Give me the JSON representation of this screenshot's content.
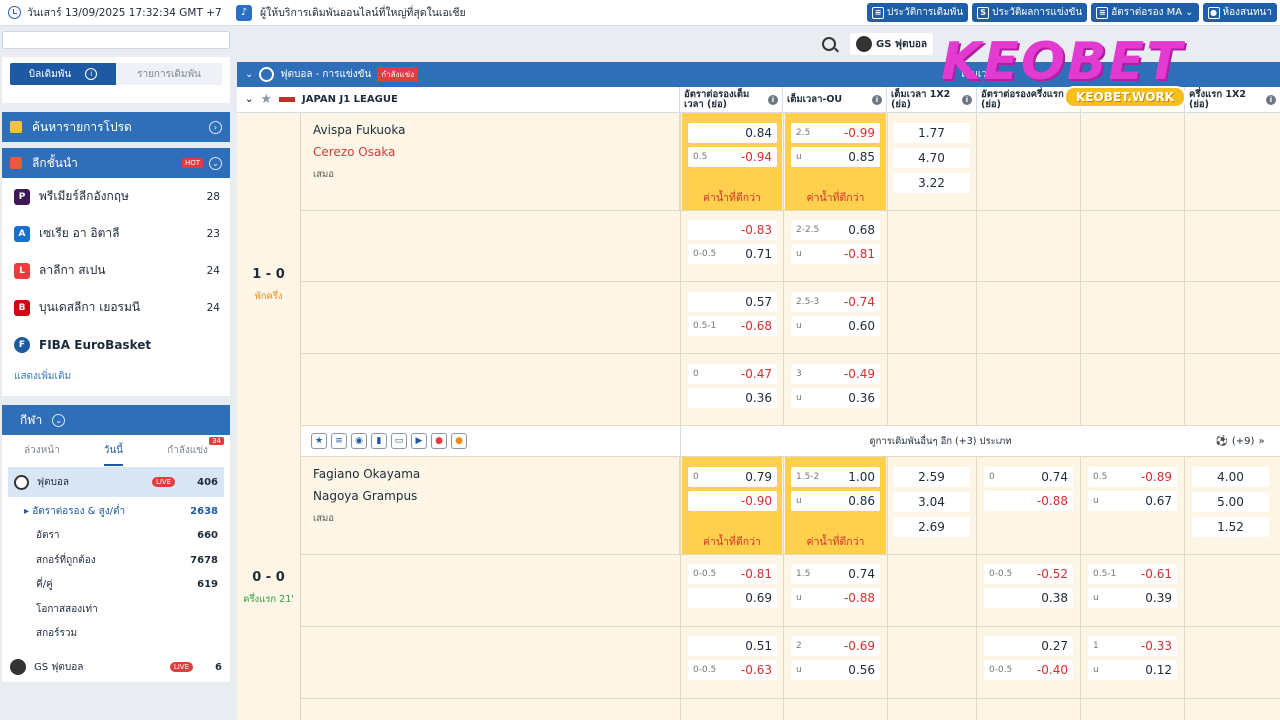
{
  "topbar": {
    "datetime": "วันเสาร์ 13/09/2025 17:32:34 GMT +7",
    "notice": "ผู้ให้บริการเดิมพันออนไลน์ที่ใหญ่ที่สุดในเอเชีย",
    "links": [
      {
        "label": "ประวัติการเดิมพัน",
        "icon": "history-icon"
      },
      {
        "label": "ประวัติผลการแข่งขัน",
        "icon": "results-icon"
      },
      {
        "label": "อัตราต่อรอง MA",
        "icon": "menu-icon"
      },
      {
        "label": "ห้องสนทนา",
        "icon": "chat-icon"
      }
    ]
  },
  "sidebar": {
    "tab_bets": "บิลเดิมพัน",
    "tab_list": "รายการเดิมพัน",
    "favorites": "ค้นหารายการโปรด",
    "top_leagues": "ลีกชั้นนำ",
    "hot": "HOT",
    "leagues": [
      {
        "name": "พรีเมียร์ลีกอังกฤษ",
        "count": "28",
        "color": "#3d195b"
      },
      {
        "name": "เซเรีย อา อิตาลี",
        "count": "23",
        "color": "#1b6fd0"
      },
      {
        "name": "ลาลีกา สเปน",
        "count": "24",
        "color": "#ee3b3b"
      },
      {
        "name": "บุนเดสลีกา เยอรมนี",
        "count": "24",
        "color": "#d20515"
      },
      {
        "name": "FIBA EuroBasket",
        "count": "",
        "color": "#1e5aa3"
      }
    ],
    "show_more": "แสดงเพิ่มเติม",
    "sports": "กีฬา",
    "sport_tabs": [
      "ล่วงหน้า",
      "วันนี้",
      "กำลังแข่ง"
    ],
    "live_count": "34",
    "football": {
      "name": "ฟุตบอล",
      "count": "406",
      "live": "LIVE"
    },
    "subitems": [
      {
        "name": "อัตราต่อรอง & สูง/ต่ำ",
        "count": "2638"
      },
      {
        "name": "อัตรา",
        "count": "660"
      },
      {
        "name": "สกอร์ที่ถูกต้อง",
        "count": "7678"
      },
      {
        "name": "คี่/คู่",
        "count": "619"
      },
      {
        "name": "โอกาสสองเท่า",
        "count": ""
      },
      {
        "name": "สกอร์รวม",
        "count": ""
      }
    ],
    "gs": {
      "name": "GS ฟุตบอล",
      "count": "6",
      "live": "LIVE"
    }
  },
  "main": {
    "gs_pill": "GS ฟุตบอล",
    "logo": "KEOBET",
    "logo_sub": "KEOBET.WORK",
    "header_title": "ฟุตบอล - การแข่งขัน",
    "header_badge": "กำลังแข่ง",
    "header_fulltime": "เต็มเวลา",
    "league": "JAPAN J1 LEAGUE",
    "cols": [
      "อัตราต่อรองเต็มเวลา (ย่อ)",
      "เต็มเวลา-OU",
      "เต็มเวลา 1X2 (ย่อ)",
      "อัตราต่อรองครึ่งแรก (ย่อ)",
      "",
      "ครึ่งแรก 1X2 (ย่อ)"
    ],
    "better": "ค่าน้ำที่ดีกว่า",
    "draw": "เสมอ",
    "more_text": "ดูการเดิมพันอื่นๆ อีก (+3) ประเภท",
    "more_count": "(+9)",
    "match1": {
      "home": "Avispa Fukuoka",
      "away": "Cerezo Osaka",
      "score": "1 - 0",
      "status": "พักครึ่ง",
      "rows": [
        {
          "hdp": [
            "",
            "0.5"
          ],
          "hdpv": [
            "0.84",
            "-0.94"
          ],
          "ou": [
            "2.5",
            "u"
          ],
          "ouv": [
            "-0.99",
            "0.85"
          ],
          "x12": [
            "1.77",
            "4.70",
            "3.22"
          ]
        },
        {
          "hdp": [
            "",
            "0-0.5"
          ],
          "hdpv": [
            "-0.83",
            "0.71"
          ],
          "ou": [
            "2-2.5",
            "u"
          ],
          "ouv": [
            "0.68",
            "-0.81"
          ]
        },
        {
          "hdp": [
            "",
            "0.5-1"
          ],
          "hdpv": [
            "0.57",
            "-0.68"
          ],
          "ou": [
            "2.5-3",
            "u"
          ],
          "ouv": [
            "-0.74",
            "0.60"
          ]
        },
        {
          "hdp": [
            "0",
            ""
          ],
          "hdpv": [
            "-0.47",
            "0.36"
          ],
          "ou": [
            "3",
            "u"
          ],
          "ouv": [
            "-0.49",
            "0.36"
          ]
        }
      ]
    },
    "match2": {
      "home": "Fagiano Okayama",
      "away": "Nagoya Grampus",
      "score": "0 - 0",
      "status": "ครึ่งแรก 21'",
      "rows": [
        {
          "hdp": [
            "0",
            ""
          ],
          "hdpv": [
            "0.79",
            "-0.90"
          ],
          "ou": [
            "1.5-2",
            "u"
          ],
          "ouv": [
            "1.00",
            "0.86"
          ],
          "x12": [
            "2.59",
            "3.04",
            "2.69"
          ],
          "h1": [
            "0",
            ""
          ],
          "h1v": [
            "0.74",
            "-0.88"
          ],
          "h1ou": [
            "0.5",
            "u"
          ],
          "h1ouv": [
            "-0.89",
            "0.67"
          ],
          "h1x": [
            "4.00",
            "5.00",
            "1.52"
          ]
        },
        {
          "hdp": [
            "0-0.5",
            ""
          ],
          "hdpv": [
            "-0.81",
            "0.69"
          ],
          "ou": [
            "1.5",
            "u"
          ],
          "ouv": [
            "0.74",
            "-0.88"
          ],
          "h1": [
            "0-0.5",
            ""
          ],
          "h1v": [
            "-0.52",
            "0.38"
          ],
          "h1ou": [
            "0.5-1",
            "u"
          ],
          "h1ouv": [
            "-0.61",
            "0.39"
          ]
        },
        {
          "hdp": [
            "",
            "0-0.5"
          ],
          "hdpv": [
            "0.51",
            "-0.63"
          ],
          "ou": [
            "2",
            "u"
          ],
          "ouv": [
            "-0.69",
            "0.56"
          ],
          "h1": [
            "",
            "0-0.5"
          ],
          "h1v": [
            "0.27",
            "-0.40"
          ],
          "h1ou": [
            "1",
            "u"
          ],
          "h1ouv": [
            "-0.33",
            "0.12"
          ]
        }
      ]
    }
  }
}
